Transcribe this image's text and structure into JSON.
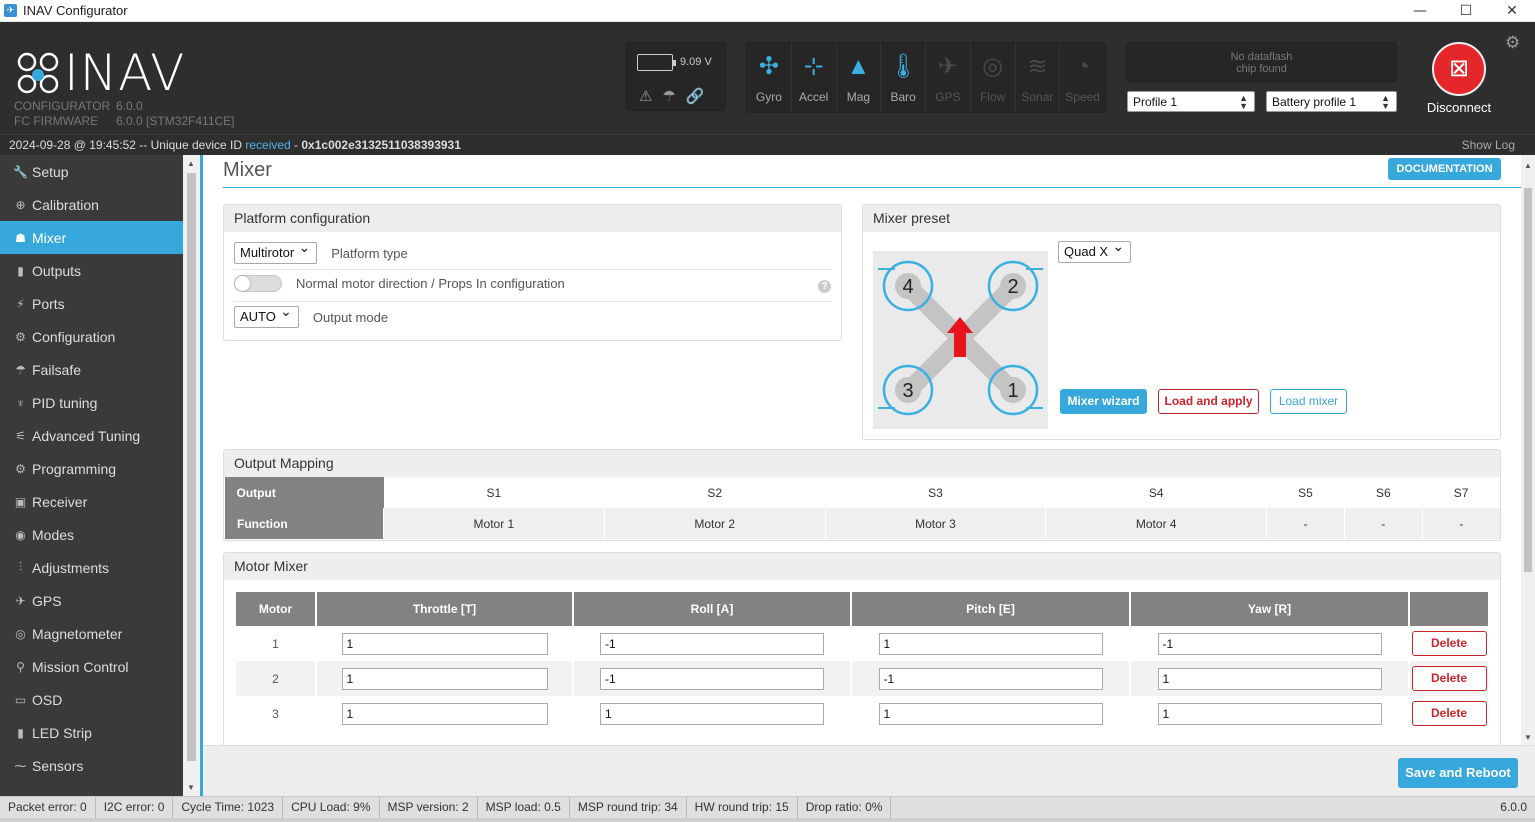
{
  "window": {
    "title": "INAV Configurator",
    "icon": "inav-app-icon",
    "minimize": "—",
    "maximize": "☐",
    "close": "✕"
  },
  "header": {
    "logo_text": "INAV",
    "configurator_label": "CONFIGURATOR",
    "configurator_version": "6.0.0",
    "firmware_label": "FC FIRMWARE",
    "firmware_version": "6.0.0 [STM32F411CE]",
    "battery_voltage": "9.09 V",
    "sensors": [
      {
        "label": "Gyro",
        "icon": "gyro-icon",
        "active": true
      },
      {
        "label": "Accel",
        "icon": "accel-icon",
        "active": true
      },
      {
        "label": "Mag",
        "icon": "mag-icon",
        "active": true
      },
      {
        "label": "Baro",
        "icon": "baro-icon",
        "active": true
      },
      {
        "label": "GPS",
        "icon": "gps-icon",
        "active": false
      },
      {
        "label": "Flow",
        "icon": "flow-icon",
        "active": false
      },
      {
        "label": "Sonar",
        "icon": "sonar-icon",
        "active": false
      },
      {
        "label": "Speed",
        "icon": "speed-icon",
        "active": false
      }
    ],
    "dataflash_line1": "No dataflash",
    "dataflash_line2": "chip found",
    "profile": "Profile 1",
    "battery_profile": "Battery profile 1",
    "disconnect_label": "Disconnect"
  },
  "status": {
    "timestamp": "2024-09-28 @ 19:45:52",
    "prefix": " -- Unique device ID ",
    "received": "received",
    "dash": " - ",
    "device_id": "0x1c002e3132511038393931",
    "show_log": "Show Log"
  },
  "sidebar": {
    "items": [
      {
        "label": "Setup",
        "icon": "wrench-icon"
      },
      {
        "label": "Calibration",
        "icon": "crosshair-icon"
      },
      {
        "label": "Mixer",
        "icon": "mixer-icon",
        "active": true
      },
      {
        "label": "Outputs",
        "icon": "motor-icon"
      },
      {
        "label": "Ports",
        "icon": "plug-icon"
      },
      {
        "label": "Configuration",
        "icon": "gear-icon"
      },
      {
        "label": "Failsafe",
        "icon": "parachute-icon"
      },
      {
        "label": "PID tuning",
        "icon": "pid-icon"
      },
      {
        "label": "Advanced Tuning",
        "icon": "advanced-icon"
      },
      {
        "label": "Programming",
        "icon": "gear-icon"
      },
      {
        "label": "Receiver",
        "icon": "receiver-icon"
      },
      {
        "label": "Modes",
        "icon": "modes-icon"
      },
      {
        "label": "Adjustments",
        "icon": "sliders-icon"
      },
      {
        "label": "GPS",
        "icon": "satellite-icon"
      },
      {
        "label": "Magnetometer",
        "icon": "compass-icon"
      },
      {
        "label": "Mission Control",
        "icon": "map-pin-icon"
      },
      {
        "label": "OSD",
        "icon": "osd-icon"
      },
      {
        "label": "LED Strip",
        "icon": "led-icon"
      },
      {
        "label": "Sensors",
        "icon": "sensors-icon"
      }
    ]
  },
  "main": {
    "title": "Mixer",
    "documentation": "DOCUMENTATION",
    "platform": {
      "heading": "Platform configuration",
      "platform_type_value": "Multirotor",
      "platform_type_label": "Platform type",
      "motor_direction_label": "Normal motor direction / Props In configuration",
      "help": "?",
      "output_mode_value": "AUTO",
      "output_mode_label": "Output mode"
    },
    "preset": {
      "heading": "Mixer preset",
      "preset_value": "Quad X",
      "motor_labels": [
        "1",
        "2",
        "3",
        "4"
      ],
      "wizard": "Mixer wizard",
      "load_apply": "Load and apply",
      "load_mixer": "Load mixer"
    },
    "output_mapping": {
      "heading": "Output Mapping",
      "row1_label": "Output",
      "row2_label": "Function",
      "outputs": [
        "S1",
        "S2",
        "S3",
        "S4",
        "S5",
        "S6",
        "S7"
      ],
      "functions": [
        "Motor 1",
        "Motor 2",
        "Motor 3",
        "Motor 4",
        "-",
        "-",
        "-"
      ]
    },
    "motor_mixer": {
      "heading": "Motor Mixer",
      "columns": [
        "Motor",
        "Throttle [T]",
        "Roll [A]",
        "Pitch [E]",
        "Yaw [R]"
      ],
      "delete": "Delete",
      "rows": [
        {
          "motor": "1",
          "throttle": "1",
          "roll": "-1",
          "pitch": "1",
          "yaw": "-1"
        },
        {
          "motor": "2",
          "throttle": "1",
          "roll": "-1",
          "pitch": "-1",
          "yaw": "1"
        },
        {
          "motor": "3",
          "throttle": "1",
          "roll": "1",
          "pitch": "1",
          "yaw": "1"
        }
      ]
    },
    "save_reboot": "Save and Reboot"
  },
  "footer": {
    "items": [
      "Packet error: 0",
      "I2C error: 0",
      "Cycle Time: 1023",
      "CPU Load: 9%",
      "MSP version: 2",
      "MSP load: 0.5",
      "MSP round trip: 34",
      "HW round trip: 15",
      "Drop ratio: 0%"
    ],
    "version": "6.0.0"
  },
  "colors": {
    "accent": "#37a8db",
    "danger": "#c9252b",
    "header_bg": "#2e2e2e",
    "sidebar_bg": "#3a3a3a"
  }
}
